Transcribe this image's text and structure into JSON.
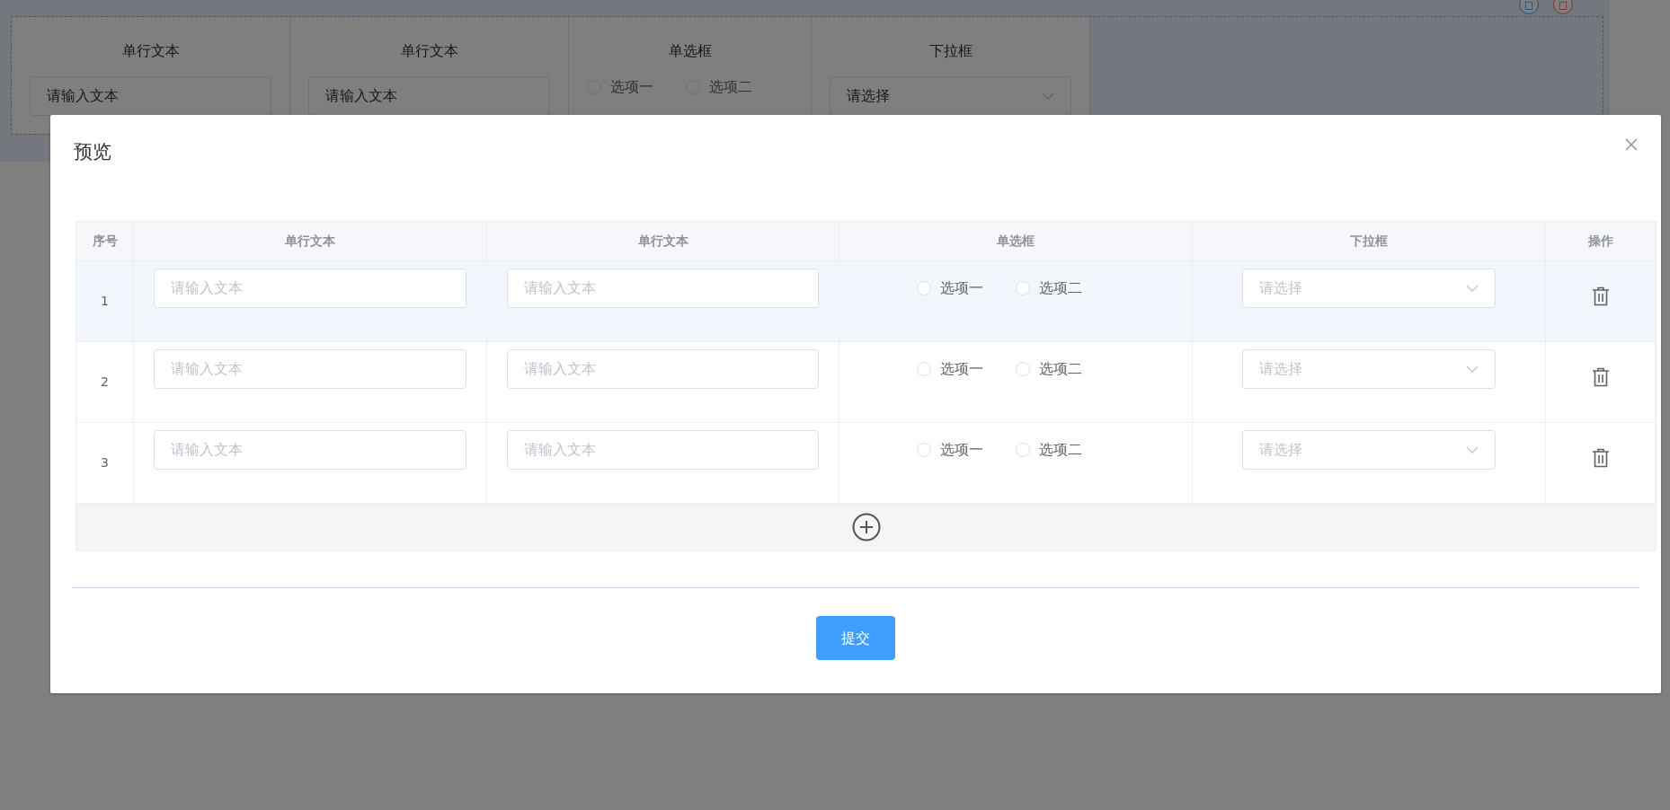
{
  "background_form": {
    "fields": [
      {
        "kind": "text",
        "label": "单行文本",
        "placeholder": "请输入文本"
      },
      {
        "kind": "text",
        "label": "单行文本",
        "placeholder": "请输入文本"
      },
      {
        "kind": "radio",
        "label": "单选框",
        "options": [
          {
            "label": "选项一",
            "selected": false
          },
          {
            "label": "选项二",
            "selected": false
          }
        ]
      },
      {
        "kind": "select",
        "label": "下拉框",
        "placeholder": "请选择"
      }
    ]
  },
  "dialog": {
    "title": "预览",
    "table": {
      "columns": [
        "序号",
        "单行文本",
        "单行文本",
        "单选框",
        "下拉框",
        "操作"
      ],
      "rows": [
        {
          "hovered": true,
          "cells": [
            {
              "kind": "index",
              "text": "1"
            },
            {
              "kind": "text",
              "placeholder": "请输入文本"
            },
            {
              "kind": "text",
              "placeholder": "请输入文本"
            },
            {
              "kind": "radio",
              "options": [
                {
                  "label": "选项一",
                  "selected": false
                },
                {
                  "label": "选项二",
                  "selected": false
                }
              ]
            },
            {
              "kind": "select",
              "placeholder": "请选择"
            },
            {
              "kind": "delete"
            }
          ]
        },
        {
          "hovered": false,
          "cells": [
            {
              "kind": "index",
              "text": "2"
            },
            {
              "kind": "text",
              "placeholder": "请输入文本"
            },
            {
              "kind": "text",
              "placeholder": "请输入文本"
            },
            {
              "kind": "radio",
              "options": [
                {
                  "label": "选项一",
                  "selected": false
                },
                {
                  "label": "选项二",
                  "selected": false
                }
              ]
            },
            {
              "kind": "select",
              "placeholder": "请选择"
            },
            {
              "kind": "delete"
            }
          ]
        },
        {
          "hovered": false,
          "cells": [
            {
              "kind": "index",
              "text": "3"
            },
            {
              "kind": "text",
              "placeholder": "请输入文本"
            },
            {
              "kind": "text",
              "placeholder": "请输入文本"
            },
            {
              "kind": "radio",
              "options": [
                {
                  "label": "选项一",
                  "selected": false
                },
                {
                  "label": "选项二",
                  "selected": false
                }
              ]
            },
            {
              "kind": "select",
              "placeholder": "请选择"
            },
            {
              "kind": "delete"
            }
          ]
        }
      ]
    },
    "submit_button": "提交"
  }
}
